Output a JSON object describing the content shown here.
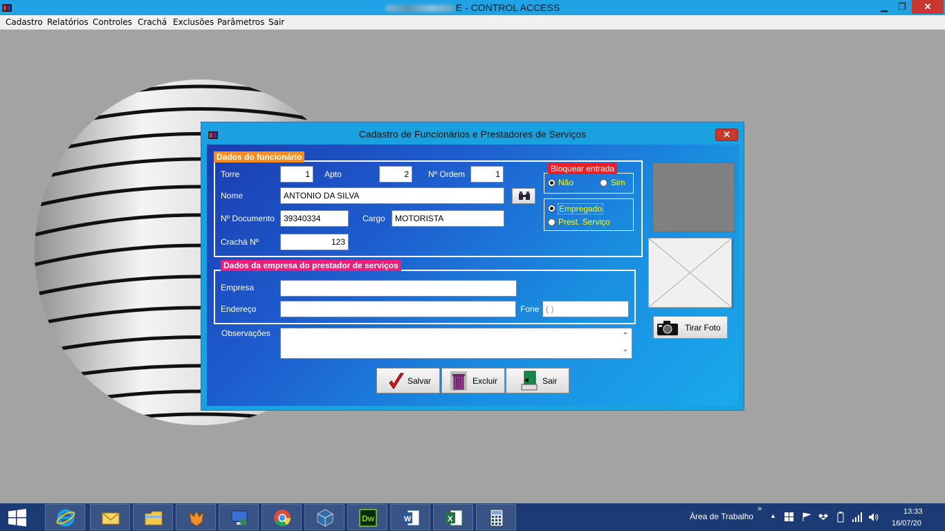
{
  "window": {
    "title": "E - CONTROL ACCESS",
    "min": "▁",
    "max": "❐",
    "close": "✕"
  },
  "menu": [
    "Cadastro",
    "Relatórios",
    "Controles",
    "Crachá",
    "Exclusões",
    "Parâmetros",
    "Sair"
  ],
  "dialog": {
    "title": "Cadastro de Funcionários e Prestadores de Serviços",
    "close": "✕",
    "func_group": {
      "legend": "Dados do funcionário",
      "torre_label": "Torre",
      "torre_value": "1",
      "apto_label": "Apto",
      "apto_value": "2",
      "ordem_label": "Nº Ordem",
      "ordem_value": "1",
      "nome_label": "Nome",
      "nome_value": "ANTONIO DA SILVA",
      "doc_label": "Nº Documento",
      "doc_value": "39340334",
      "cargo_label": "Cargo",
      "cargo_value": "MOTORISTA",
      "cracha_label": "Crachá Nº",
      "cracha_value": "123"
    },
    "bloquear": {
      "legend": "Bloquear entrada",
      "nao": "Não",
      "sim": "Sim",
      "selected": "Não"
    },
    "tipo": {
      "empregado": "Empregado",
      "prestador": "Prest. Serviço",
      "selected": "Empregado"
    },
    "empresa_group": {
      "legend": "Dados da empresa do prestador de serviços",
      "empresa_label": "Empresa",
      "empresa_value": "",
      "endereco_label": "Endereço",
      "endereco_value": "",
      "fone_label": "Fone",
      "fone_value": "( )"
    },
    "obs_label": "Observações",
    "obs_value": "",
    "tirar_foto": "Tirar Foto",
    "buttons": {
      "salvar": "Salvar",
      "excluir": "Excluir",
      "sair": "Sair"
    },
    "colors": {
      "legend_orange": "#ff8c1a",
      "legend_red": "#e8202a",
      "legend_pink": "#e8207a",
      "radio_text": "#ffff00"
    }
  },
  "taskbar": {
    "apps": [
      "internet-explorer",
      "outlook",
      "file-explorer",
      "app-fox",
      "remote-desktop",
      "chrome",
      "virtualbox",
      "dreamweaver",
      "word",
      "excel",
      "calculator"
    ],
    "tray_label": "Área de Trabalho",
    "time": "13:33",
    "date": "16/07/20"
  }
}
